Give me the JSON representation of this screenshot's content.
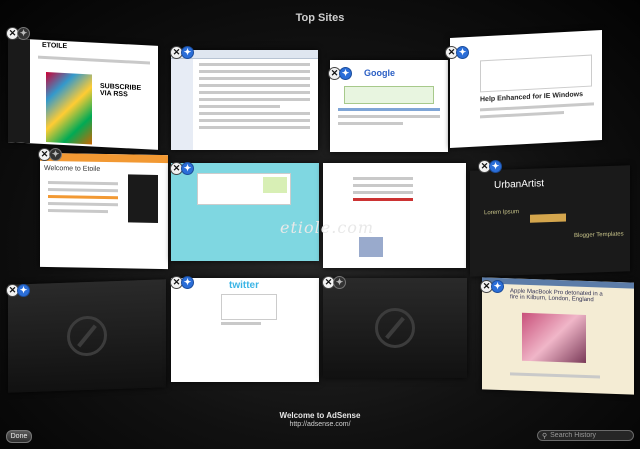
{
  "header": {
    "title": "Top Sites"
  },
  "tiles": [
    {
      "text_a": "ETOILE",
      "text_b": "SUBSCRIBE VIA RSS"
    },
    {
      "text_a": ""
    },
    {
      "text_a": "Google",
      "text_b": "Help Enhanced for IE Windows"
    },
    {
      "text_a": ""
    },
    {
      "text_a": "Welcome to Etoile"
    },
    {
      "text_a": ""
    },
    {
      "text_a": ""
    },
    {
      "text_a": "UrbanArtist",
      "text_b": "Lorem Ipsum",
      "text_c": "Blogger Templates"
    },
    {
      "text_a": ""
    },
    {
      "text_a": "twitter"
    },
    {
      "text_a": ""
    },
    {
      "text_a": "Apple MacBook Pro detonated in a fire in Kilburn, London, England"
    }
  ],
  "watermark": "etiole.com",
  "selected_site": {
    "title": "Welcome to AdSense",
    "url": "http://adsense.com/"
  },
  "footer": {
    "done_label": "Done",
    "search_placeholder": "Search History"
  },
  "colors": {
    "accent": "#2b6ed8",
    "background": "#050505"
  }
}
